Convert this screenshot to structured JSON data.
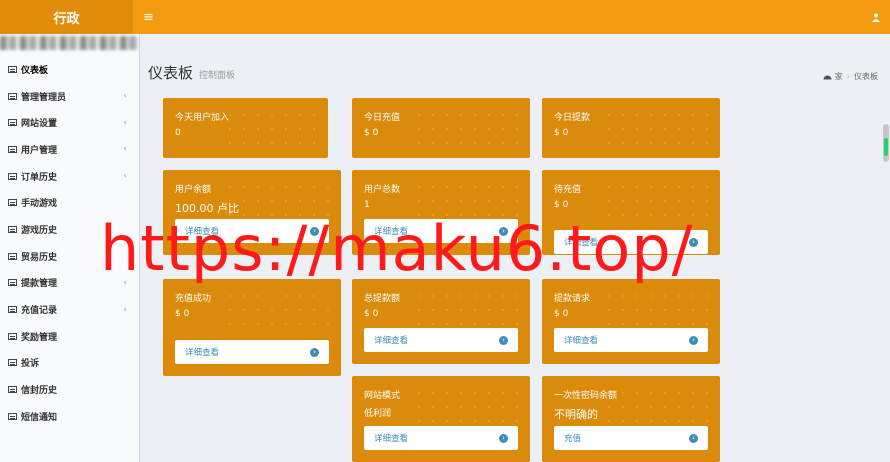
{
  "header": {
    "brand": "行政",
    "menu_icon": "≡",
    "user_icon": "user-icon"
  },
  "sidebar": {
    "items": [
      {
        "label": "仪表板",
        "chevron": ""
      },
      {
        "label": "管理管理员",
        "chevron": "‹"
      },
      {
        "label": "网站设置",
        "chevron": "‹"
      },
      {
        "label": "用户管理",
        "chevron": "‹"
      },
      {
        "label": "订单历史",
        "chevron": "‹"
      },
      {
        "label": "手动游戏",
        "chevron": ""
      },
      {
        "label": "游戏历史",
        "chevron": ""
      },
      {
        "label": "贸易历史",
        "chevron": ""
      },
      {
        "label": "提款管理",
        "chevron": "‹"
      },
      {
        "label": "充值记录",
        "chevron": "‹"
      },
      {
        "label": "奖励管理",
        "chevron": ""
      },
      {
        "label": "投诉",
        "chevron": ""
      },
      {
        "label": "信封历史",
        "chevron": ""
      },
      {
        "label": "短信通知",
        "chevron": ""
      }
    ]
  },
  "content": {
    "title": "仪表板",
    "subtitle": "控制面板",
    "breadcrumb": {
      "home": "家",
      "sep": "›",
      "current": "仪表板"
    }
  },
  "cards": [
    {
      "label": "今天用户加入",
      "value": "0"
    },
    {
      "label": "今日充值",
      "value": "$ 0"
    },
    {
      "label": "今日提款",
      "value": "$ 0"
    },
    {
      "label": "用户余额",
      "value": "100.00 卢比",
      "more": "详细查看"
    },
    {
      "label": "用户总数",
      "value": "1",
      "more": "详细查看"
    },
    {
      "label": "待充值",
      "value": "$ 0",
      "more": "详细查看"
    },
    {
      "label": "充值成功",
      "value": "$ 0",
      "more": "详细查看"
    },
    {
      "label": "总提款额",
      "value": "$ 0",
      "more": "详细查看"
    },
    {
      "label": "提款请求",
      "value": "$ 0",
      "more": "详细查看"
    },
    {
      "label": "网站模式",
      "value": "低利润",
      "more": "详细查看"
    },
    {
      "label": "一次性密码余额",
      "value": "不明确的",
      "more": "充值"
    }
  ],
  "watermark": "https://maku6.top/",
  "colors": {
    "header": "#f39c12",
    "brand_bg": "#e08e0b",
    "card": "#db8b0b",
    "link": "#3c8dbc"
  }
}
